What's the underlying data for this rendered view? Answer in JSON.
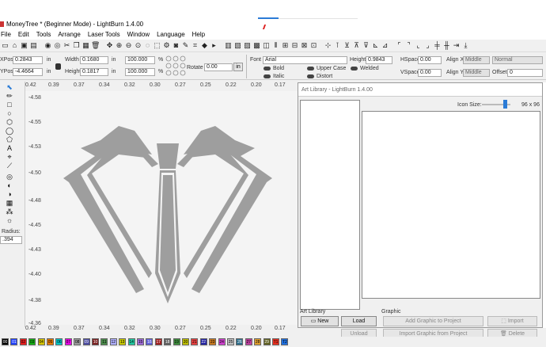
{
  "window": {
    "title": "MoneyTree * (Beginner Mode) - LightBurn 1.4.00"
  },
  "menu": [
    "File",
    "Edit",
    "Tools",
    "Arrange",
    "Laser Tools",
    "Window",
    "Language",
    "Help"
  ],
  "properties": {
    "xpos_label": "XPos",
    "xpos_value": "0.2843",
    "xpos_unit": "in",
    "ypos_label": "YPos",
    "ypos_value": "-4.4664",
    "ypos_unit": "in",
    "width_label": "Width",
    "width_value": "0.1680",
    "width_unit": "in",
    "height_label": "Height",
    "height_value": "0.1817",
    "height_unit": "in",
    "scale_x": "100.000",
    "scale_y": "100.000",
    "percent": "%",
    "rotate_label": "Rotate",
    "rotate_value": "0.00",
    "rotate_unit": "in",
    "font_label": "Font",
    "font_value": "Arial",
    "text_height_label": "Height",
    "text_height_value": "0.9843",
    "hspace_label": "HSpace",
    "hspace_value": "0.00",
    "vspace_label": "VSpace",
    "vspace_value": "0.00",
    "alignx_label": "Align X",
    "alignx_value": "Middle",
    "aligny_label": "Align Y",
    "aligny_value": "Middle",
    "mode_value": "Normal",
    "offset_label": "Offset",
    "offset_value": "0",
    "bold": "Bold",
    "italic": "Italic",
    "upper_case": "Upper Case",
    "distort": "Distort",
    "welded": "Welded"
  },
  "radius": {
    "label": "Radius:",
    "value": ".394"
  },
  "ruler": {
    "top": [
      "0.42",
      "0.39",
      "0.37",
      "0.34",
      "0.32",
      "0.30",
      "0.27",
      "0.25",
      "0.22",
      "0.20",
      "0.17"
    ],
    "left": [
      "-4.58",
      "-4.55",
      "-4.53",
      "-4.50",
      "-4.48",
      "-4.45",
      "-4.43",
      "-4.40",
      "-4.38",
      "-4.36"
    ]
  },
  "art_library": {
    "title": "Art Library - LightBurn 1.4.00",
    "icon_size_label": "Icon Size:",
    "icon_size_value": "96 x 96",
    "section_library": "Art Library",
    "section_graphic": "Graphic",
    "new": "New",
    "load": "Load",
    "unload": "Unload",
    "add_graphic": "Add Graphic to Project",
    "import_graphic": "Import Graphic from Project",
    "import": "Import",
    "delete": "Delete"
  },
  "palette": [
    "00",
    "01",
    "02",
    "03",
    "04",
    "05",
    "06",
    "07",
    "08",
    "09",
    "10",
    "11",
    "12",
    "13",
    "14",
    "15",
    "16",
    "17",
    "18",
    "19",
    "20",
    "21",
    "22",
    "23",
    "24",
    "25",
    "26",
    "27",
    "28",
    "29",
    "T1",
    "T2"
  ],
  "palette_colors": [
    "#000000",
    "#1f3fff",
    "#e81e1e",
    "#15b015",
    "#d4c400",
    "#e87a00",
    "#00c8c8",
    "#e800e8",
    "#9a9a9a",
    "#4a4aa0",
    "#7a2020",
    "#4a8a4a",
    "#b0b0ff",
    "#c8c800",
    "#20c8a0",
    "#a06ad8",
    "#6060d8",
    "#a02020",
    "#606060",
    "#3d8d3d",
    "#c0c000",
    "#e84040",
    "#2020a0",
    "#c87a20",
    "#d040d0",
    "#c0c0c0",
    "#2c6d8a",
    "#c040a0",
    "#e0a030",
    "#606020",
    "#e83020",
    "#2070e0"
  ]
}
